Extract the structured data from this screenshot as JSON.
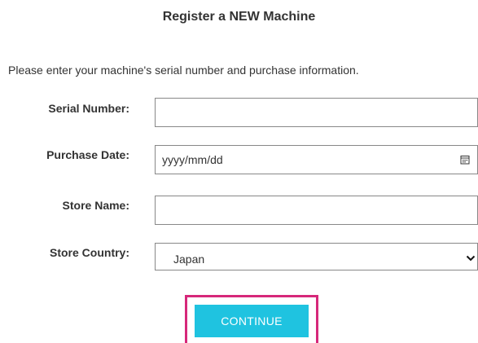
{
  "header": {
    "title": "Register a NEW Machine"
  },
  "form": {
    "intro": "Please enter your machine's serial number and purchase information.",
    "serial": {
      "label": "Serial Number:",
      "value": ""
    },
    "purchase_date": {
      "label": "Purchase Date:",
      "placeholder": "yyyy/mm/dd",
      "icon": "calendar-icon"
    },
    "store_name": {
      "label": "Store Name:",
      "value": ""
    },
    "store_country": {
      "label": "Store Country:",
      "selected": "Japan",
      "icon": "chevron-down-icon"
    },
    "continue_label": "CONTINUE"
  },
  "colors": {
    "button_bg": "#1fc3e0",
    "highlight_border": "#d6287a",
    "text": "#333333",
    "field_border": "#888888"
  }
}
